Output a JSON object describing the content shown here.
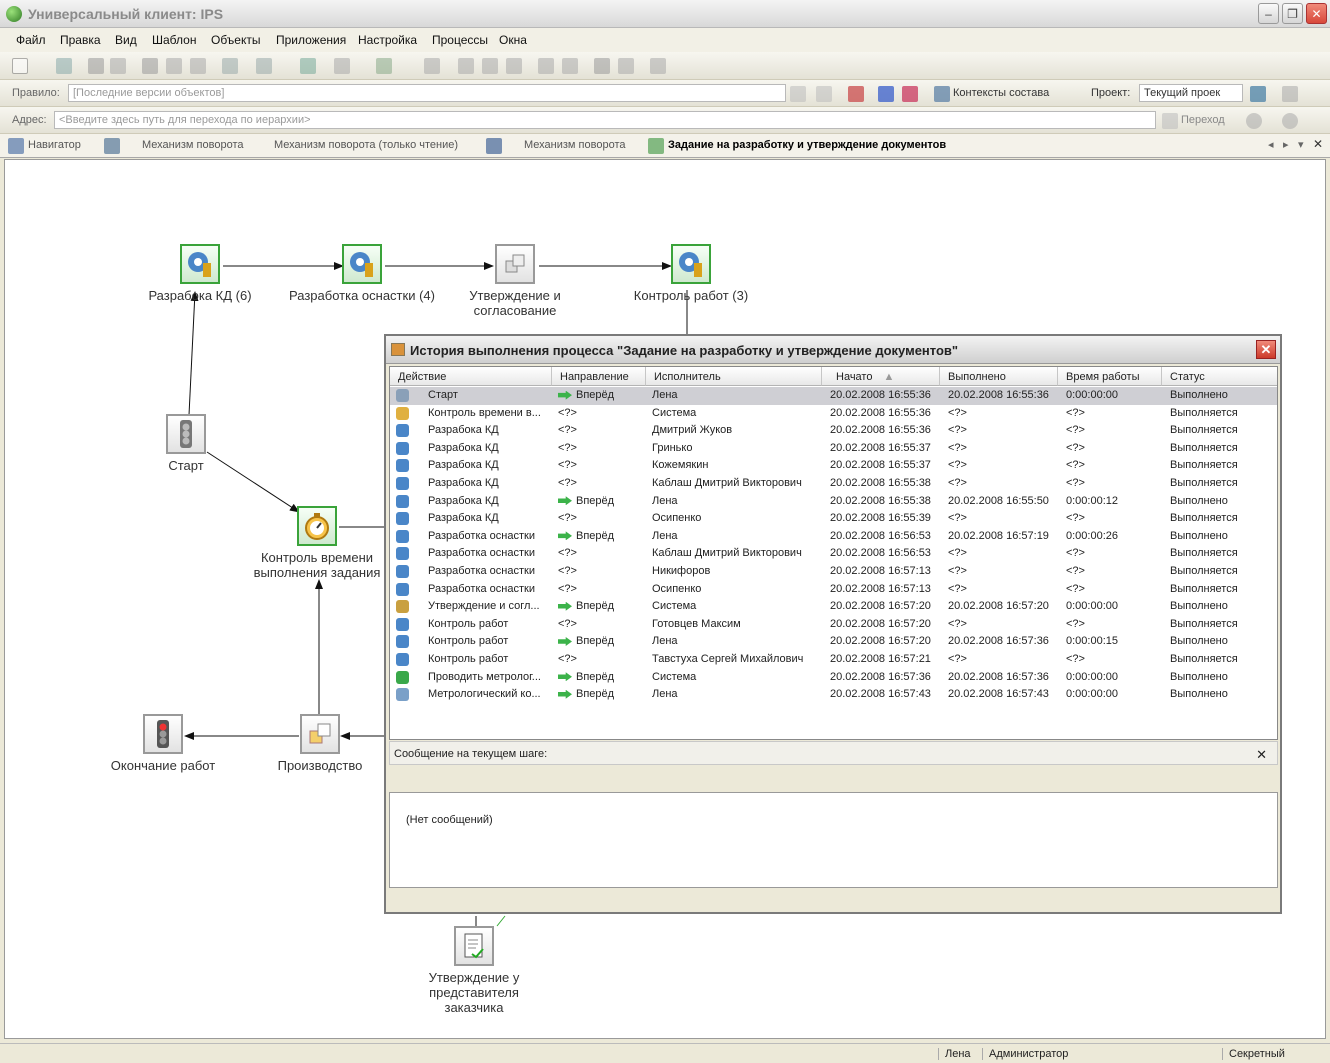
{
  "window": {
    "title": "Универсальный клиент: IPS"
  },
  "menu": [
    "Файл",
    "Правка",
    "Вид",
    "Шаблон",
    "Объекты",
    "Приложения",
    "Настройка",
    "Процессы",
    "Окна"
  ],
  "toolbar": {
    "rule_label": "Правило:",
    "rule_value": "[Последние версии объектов]",
    "context_button": "Контексты состава",
    "project_label": "Проект:",
    "project_value": "Текущий проек",
    "address_label": "Адрес:",
    "address_placeholder": "<Введите здесь путь для перехода по иерархии>",
    "go_button": "Переход"
  },
  "tabs": [
    "Навигатор",
    "Механизм поворота",
    "Механизм поворота (только чтение)",
    "Механизм поворота",
    "Задание на разработку и утверждение документов"
  ],
  "diagram": {
    "nodes": {
      "n1": "Разрабока КД (6)",
      "n2": "Разработка оснастки (4)",
      "n3": "Утверждение и согласование",
      "n4": "Контроль работ (3)",
      "n5": "Старт",
      "n6": "Контроль времени выполнения задания",
      "n7": "Окончание работ",
      "n8": "Производство",
      "n9": "Утверждение у представителя заказчика"
    }
  },
  "dialog": {
    "title": "История выполнения процесса \"Задание на разработку и утверждение документов\"",
    "columns": [
      "Действие",
      "Направление",
      "Исполнитель",
      "Начато",
      "Выполнено",
      "Время работы",
      "Статус"
    ],
    "rows": [
      [
        "Старт",
        "Вперёд",
        "Лена",
        "20.02.2008 16:55:36",
        "20.02.2008 16:55:36",
        "0:00:00:00",
        "Выполнено"
      ],
      [
        "Контроль времени в...",
        "<?>",
        "Система",
        "20.02.2008 16:55:36",
        "<?>",
        "<?>",
        "Выполняется"
      ],
      [
        "Разрабока КД",
        "<?>",
        "Дмитрий Жуков",
        "20.02.2008 16:55:36",
        "<?>",
        "<?>",
        "Выполняется"
      ],
      [
        "Разрабока КД",
        "<?>",
        "Гринько",
        "20.02.2008 16:55:37",
        "<?>",
        "<?>",
        "Выполняется"
      ],
      [
        "Разрабока КД",
        "<?>",
        "Кожемякин",
        "20.02.2008 16:55:37",
        "<?>",
        "<?>",
        "Выполняется"
      ],
      [
        "Разрабока КД",
        "<?>",
        "Каблаш Дмитрий Викторович",
        "20.02.2008 16:55:38",
        "<?>",
        "<?>",
        "Выполняется"
      ],
      [
        "Разрабока КД",
        "Вперёд",
        "Лена",
        "20.02.2008 16:55:38",
        "20.02.2008 16:55:50",
        "0:00:00:12",
        "Выполнено"
      ],
      [
        "Разрабока КД",
        "<?>",
        "Осипенко",
        "20.02.2008 16:55:39",
        "<?>",
        "<?>",
        "Выполняется"
      ],
      [
        "Разработка оснастки",
        "Вперёд",
        "Лена",
        "20.02.2008 16:56:53",
        "20.02.2008 16:57:19",
        "0:00:00:26",
        "Выполнено"
      ],
      [
        "Разработка оснастки",
        "<?>",
        "Каблаш Дмитрий Викторович",
        "20.02.2008 16:56:53",
        "<?>",
        "<?>",
        "Выполняется"
      ],
      [
        "Разработка оснастки",
        "<?>",
        "Никифоров",
        "20.02.2008 16:57:13",
        "<?>",
        "<?>",
        "Выполняется"
      ],
      [
        "Разработка оснастки",
        "<?>",
        "Осипенко",
        "20.02.2008 16:57:13",
        "<?>",
        "<?>",
        "Выполняется"
      ],
      [
        "Утверждение и согл...",
        "Вперёд",
        "Система",
        "20.02.2008 16:57:20",
        "20.02.2008 16:57:20",
        "0:00:00:00",
        "Выполнено"
      ],
      [
        "Контроль работ",
        "<?>",
        "Готовцев Максим",
        "20.02.2008 16:57:20",
        "<?>",
        "<?>",
        "Выполняется"
      ],
      [
        "Контроль работ",
        "Вперёд",
        "Лена",
        "20.02.2008 16:57:20",
        "20.02.2008 16:57:36",
        "0:00:00:15",
        "Выполнено"
      ],
      [
        "Контроль работ",
        "<?>",
        "Тавстуха Сергей Михайлович",
        "20.02.2008 16:57:21",
        "<?>",
        "<?>",
        "Выполняется"
      ],
      [
        "Проводить метролог...",
        "Вперёд",
        "Система",
        "20.02.2008 16:57:36",
        "20.02.2008 16:57:36",
        "0:00:00:00",
        "Выполнено"
      ],
      [
        "Метрологический ко...",
        "Вперёд",
        "Лена",
        "20.02.2008 16:57:43",
        "20.02.2008 16:57:43",
        "0:00:00:00",
        "Выполнено"
      ]
    ],
    "message_label": "Сообщение на текущем шаге:",
    "message_text": "(Нет сообщений)"
  },
  "status": {
    "user": "Лена",
    "role": "Администратор",
    "security": "Секретный"
  }
}
